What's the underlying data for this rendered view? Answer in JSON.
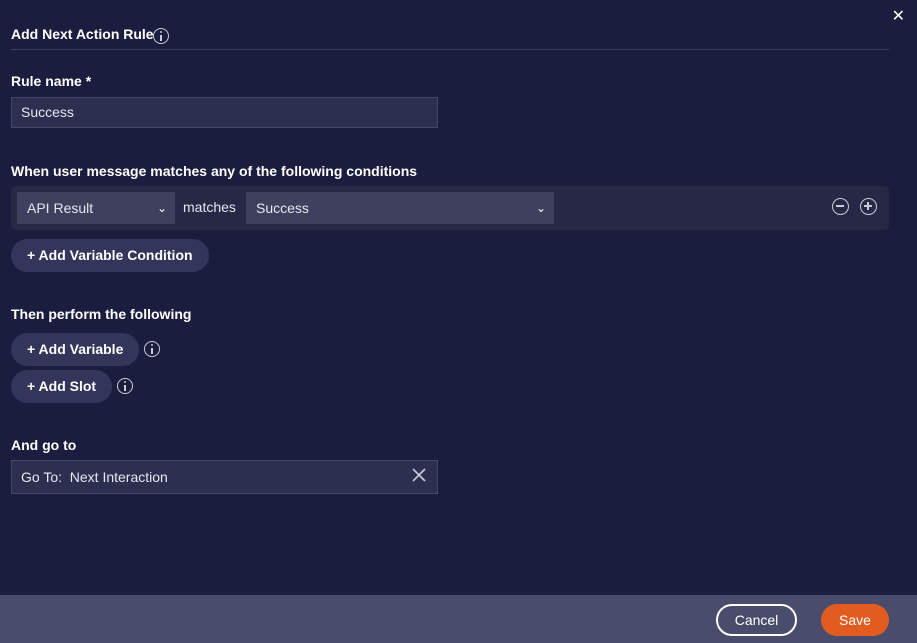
{
  "dialog": {
    "title": "Add Next Action Rule",
    "close_icon": "close-icon"
  },
  "rule_name": {
    "label": "Rule name *",
    "value": "Success"
  },
  "conditions": {
    "label": "When user message matches any of the following conditions",
    "rows": [
      {
        "variable": "API Result",
        "operator": "matches",
        "value": "Success"
      }
    ],
    "add_button": "+ Add Variable Condition"
  },
  "actions": {
    "label": "Then perform the following",
    "add_variable": "+ Add Variable",
    "add_slot": "+ Add Slot"
  },
  "goto": {
    "label": "And go to",
    "prefix": "Go To:",
    "value": "Next Interaction"
  },
  "footer": {
    "cancel": "Cancel",
    "save": "Save"
  },
  "colors": {
    "background": "#1b1d3e",
    "footer": "#4a4c6c",
    "accent": "#e25c22"
  }
}
